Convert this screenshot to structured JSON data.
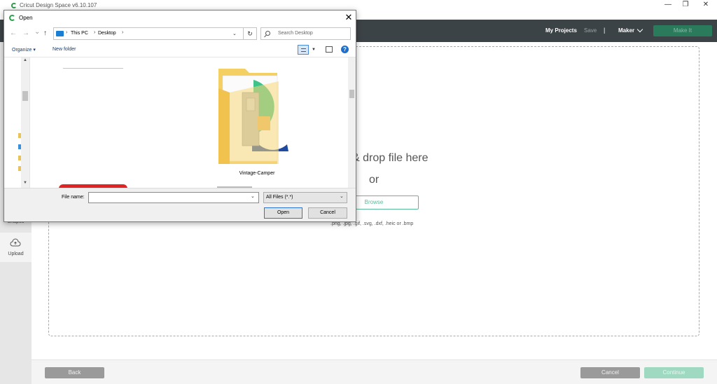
{
  "app": {
    "title": "Cricut Design Space  v6.10.107",
    "window_controls": {
      "minimize": "—",
      "maximize": "❐",
      "close": "✕"
    }
  },
  "header": {
    "my_projects": "My Projects",
    "save": "Save",
    "separator": "|",
    "machine": "Maker",
    "make_it": "Make It"
  },
  "left_rail": {
    "shapes_label": "Shapes",
    "upload_label": "Upload"
  },
  "upload_area": {
    "drop_text": "& drop file here",
    "or_text": "or",
    "browse_label": "Browse",
    "formats": ".png, .jpg, .gif, .svg, .dxf, .heic or .bmp"
  },
  "footer": {
    "back": "Back",
    "cancel": "Cancel",
    "continue": "Continue"
  },
  "dialog": {
    "title": "Open",
    "close": "✕",
    "nav": {
      "back": "←",
      "forward": "→",
      "recent": "⌄",
      "up": "↑"
    },
    "breadcrumbs": [
      {
        "label": "This PC",
        "sep": "›"
      },
      {
        "label": "Desktop",
        "sep": "›"
      }
    ],
    "search_placeholder": "Search Desktop",
    "toolbar": {
      "organize": "Organize ▾",
      "new_folder": "New folder",
      "help": "?"
    },
    "files": [
      {
        "name": "Vintage-Camper",
        "type": "folder"
      }
    ],
    "file_name_label": "File name:",
    "file_name_value": "",
    "filter_value": "All Files (*.*)",
    "open_label": "Open",
    "cancel_label": "Cancel"
  },
  "colors": {
    "header_bg": "#3c4347",
    "accent_green": "#5cb996",
    "make_it_bg": "#2a7a5c",
    "continue_bg": "#9fd9c2",
    "dialog_focus": "#2b75d1"
  }
}
